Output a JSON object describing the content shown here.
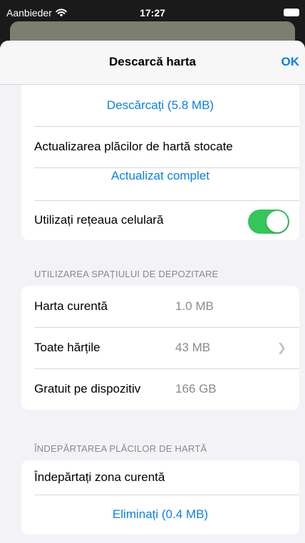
{
  "status": {
    "carrier": "Aanbieder",
    "time": "17:27"
  },
  "nav": {
    "title": "Descarcă harta",
    "ok": "OK"
  },
  "download_section": {
    "download_button": "Descărcați (5.8 MB)",
    "update_label": "Actualizarea plăcilor de hartă stocate",
    "update_status": "Actualizat complet",
    "cellular_label": "Utilizați rețeaua celulară",
    "cellular_enabled": true
  },
  "storage_section": {
    "header": "UTILIZAREA SPAȚIULUI DE DEPOZITARE",
    "rows": [
      {
        "label": "Harta curentă",
        "value": "1.0 MB"
      },
      {
        "label": "Toate hărțile",
        "value": "43 MB"
      },
      {
        "label": "Gratuit pe dispozitiv",
        "value": "166 GB"
      }
    ]
  },
  "remove_section": {
    "header": "ÎNDEPĂRTAREA PLĂCILOR DE HARTĂ",
    "remove_label": "Îndepărtați zona curentă",
    "remove_button": "Eliminați (0.4 MB)"
  },
  "colors": {
    "accent": "#0a7ef0",
    "toggle_on": "#34c759",
    "background": "#f2f2f7"
  }
}
